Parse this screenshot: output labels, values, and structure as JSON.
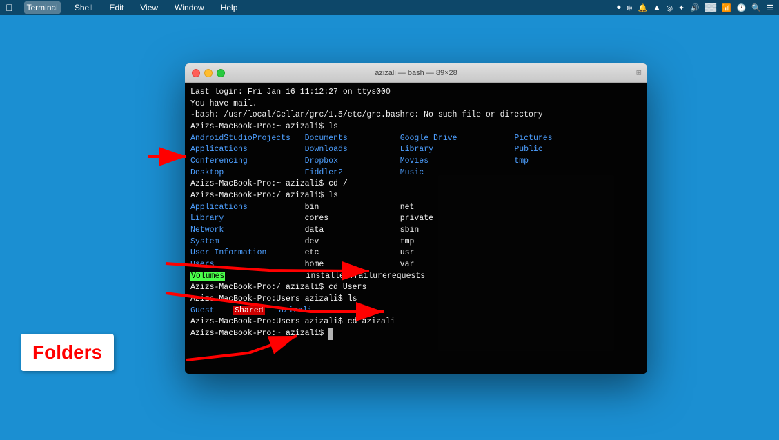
{
  "menubar": {
    "apple": "⌘",
    "items": [
      "Terminal",
      "Shell",
      "Edit",
      "View",
      "Window",
      "Help"
    ],
    "active_item": "Terminal",
    "right_icons": [
      "●",
      "◉",
      "🔔",
      "▲",
      "◎",
      "✦",
      "♦",
      "⊕",
      "◀",
      "▶",
      "●",
      "◈",
      "○",
      "🔍",
      "☰"
    ]
  },
  "terminal": {
    "title": "azizali — bash — 89×28",
    "lines": [
      {
        "type": "white",
        "text": "Last login: Fri Jan 16 11:12:27 on ttys000"
      },
      {
        "type": "white",
        "text": "You have mail."
      },
      {
        "type": "white",
        "text": "-bash: /usr/local/Cellar/grc/1.5/etc/grc.bashrc: No such file or directory"
      },
      {
        "type": "prompt",
        "text": "Azizs-MacBook-Pro:~ azizali$ ls"
      },
      {
        "type": "ls_row1",
        "col1": "AndroidStudioProjects",
        "col2": "Documents",
        "col3": "Google Drive",
        "col4": "Pictures"
      },
      {
        "type": "ls_row2",
        "col1": "Applications",
        "col2": "Downloads",
        "col3": "Library",
        "col4": "Public"
      },
      {
        "type": "ls_row3_highlight",
        "col1": "Conferencing",
        "col2": "Dropbox",
        "col3": "Movies",
        "col4": "tmp"
      },
      {
        "type": "ls_row4",
        "col1": "Desktop",
        "col2": "Fiddler2",
        "col3": "Music",
        "col4": ""
      },
      {
        "type": "prompt",
        "text": "Azizs-MacBook-Pro:~ azizali$ cd /"
      },
      {
        "type": "prompt",
        "text": "Azizs-MacBook-Pro:/ azizali$ ls"
      },
      {
        "type": "ls2_row1",
        "col1": "Applications",
        "col2": "bin",
        "col3": "net",
        "col4": ""
      },
      {
        "type": "ls2_row2",
        "col1": "Library",
        "col2": "cores",
        "col3": "private",
        "col4": ""
      },
      {
        "type": "ls2_row3",
        "col1": "Network",
        "col2": "data",
        "col3": "sbin",
        "col4": ""
      },
      {
        "type": "ls2_row4",
        "col1": "System",
        "col2": "dev",
        "col3": "tmp",
        "col4": ""
      },
      {
        "type": "ls2_row5",
        "col1": "User Information",
        "col2": "etc",
        "col3": "usr",
        "col4": ""
      },
      {
        "type": "ls2_row6",
        "col1": "Users",
        "col2": "home",
        "col3": "var",
        "col4": ""
      },
      {
        "type": "ls2_row7_vol",
        "col1": "Volumes",
        "col2": "installer.failurerequests",
        "col3": "",
        "col4": ""
      },
      {
        "type": "prompt",
        "text": "Azizs-MacBook-Pro:/ azizali$ cd Users ←"
      },
      {
        "type": "prompt",
        "text": "Azizs-MacBook-Pro:Users azizali$ ls"
      },
      {
        "type": "users_row",
        "col1": "Guest",
        "col2_highlight": "Shared",
        "col3": "azizali"
      },
      {
        "type": "prompt",
        "text": "Azizs-MacBook-Pro:Users azizali$ cd azizali ←"
      },
      {
        "type": "prompt_last",
        "text": "Azizs-MacBook-Pro:~ azizali$ "
      }
    ]
  },
  "annotation": {
    "folders_label": "Folders"
  }
}
